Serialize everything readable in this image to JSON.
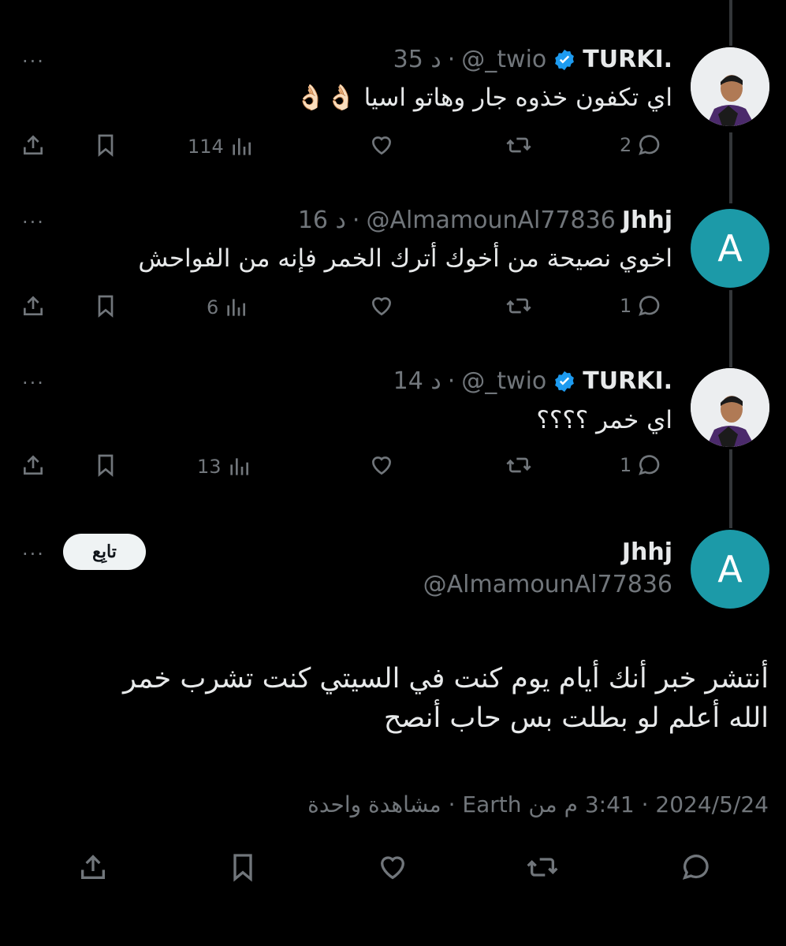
{
  "replies": [
    {
      "name": "TURKI.",
      "handle": "@_twio",
      "dot": "·",
      "time": "35 د",
      "text": "اي تكفون خذوه جار وهاتو اسيا 👌🏻👌🏻",
      "views": "114",
      "retweets": "",
      "replies": "2"
    },
    {
      "name": "Jhhj",
      "handle": "@AlmamounAl77836",
      "dot": "·",
      "time": "16 د",
      "avatar_letter": "A",
      "text": "اخوي نصيحة من أخوك أترك الخمر فإنه من الفواحش",
      "views": "6",
      "retweets": "",
      "replies": "1"
    },
    {
      "name": "TURKI.",
      "handle": "@_twio",
      "dot": "·",
      "time": "14 د",
      "text": "اي خمر ؟؟؟؟",
      "views": "13",
      "retweets": "",
      "replies": "1"
    }
  ],
  "main": {
    "avatar_letter": "A",
    "name": "Jhhj",
    "handle": "@AlmamounAl77836",
    "follow_label": "تابِع",
    "text_line1": "أنتشر خبر أنك أيام يوم كنت في السيتي كنت تشرب خمر",
    "text_line2": "الله أعلم لو بطلت بس حاب أنصح",
    "meta": "2024/5/24 · 3:41 م من Earth · مشاهدة واحدة"
  },
  "more_label": "···",
  "colors": {
    "background": "#000000",
    "text": "#e7e9ea",
    "muted": "#71767b",
    "avatar_teal": "#1c9aa8",
    "verified": "#1d9bf0"
  }
}
